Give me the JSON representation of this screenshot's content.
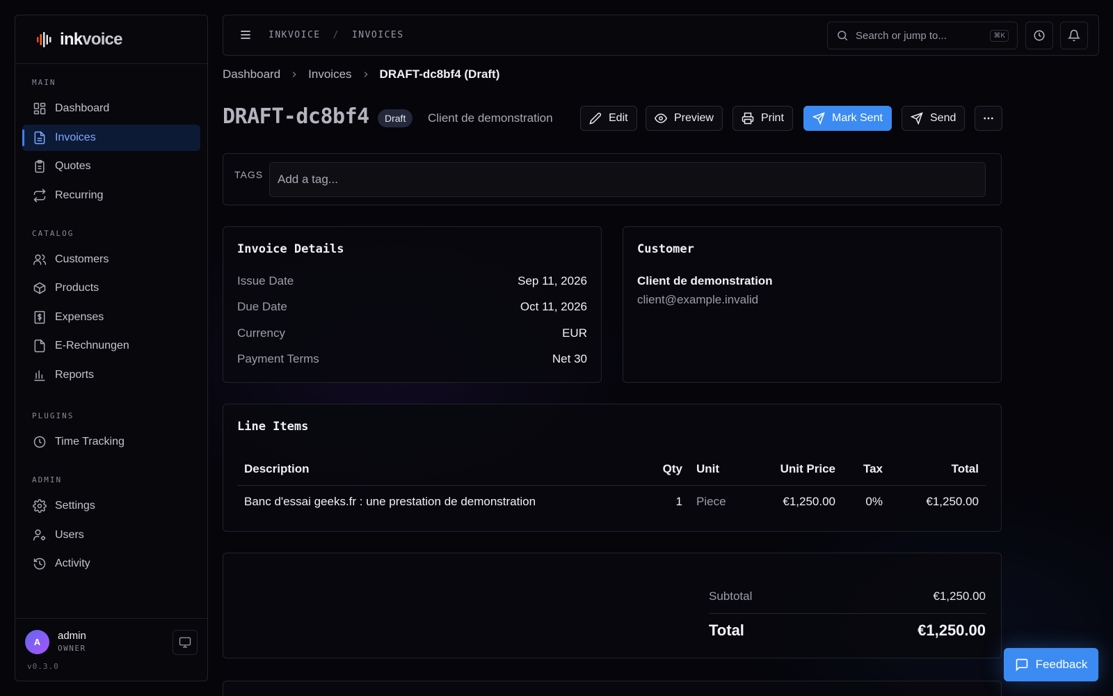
{
  "app": {
    "logo_text_bold": "ink",
    "logo_text_rest": "voice"
  },
  "sidebar": {
    "sections": [
      {
        "label": "MAIN"
      },
      {
        "label": "CATALOG"
      },
      {
        "label": "PLUGINS"
      },
      {
        "label": "ADMIN"
      }
    ],
    "items": [
      {
        "label": "Dashboard",
        "icon": "dashboard-icon"
      },
      {
        "label": "Invoices",
        "icon": "file-text-icon",
        "active": true
      },
      {
        "label": "Quotes",
        "icon": "clipboard-icon"
      },
      {
        "label": "Recurring",
        "icon": "repeat-icon"
      },
      {
        "label": "Customers",
        "icon": "users-icon"
      },
      {
        "label": "Products",
        "icon": "package-icon"
      },
      {
        "label": "Expenses",
        "icon": "receipt-icon"
      },
      {
        "label": "E-Rechnungen",
        "icon": "file-icon"
      },
      {
        "label": "Reports",
        "icon": "bar-chart-icon"
      },
      {
        "label": "Time Tracking",
        "icon": "clock-icon"
      },
      {
        "label": "Settings",
        "icon": "gear-icon"
      },
      {
        "label": "Users",
        "icon": "user-cog-icon"
      },
      {
        "label": "Activity",
        "icon": "history-icon"
      }
    ],
    "user": {
      "initial": "A",
      "name": "admin",
      "role": "OWNER"
    },
    "version": "v0.3.0"
  },
  "topbar": {
    "crumbs": [
      "INKVOICE",
      "/",
      "INVOICES"
    ],
    "search_placeholder": "Search or jump to...",
    "search_shortcut": "⌘K"
  },
  "breadcrumb": {
    "items": [
      "Dashboard",
      "Invoices"
    ],
    "current": "DRAFT-dc8bf4 (Draft)"
  },
  "header": {
    "title": "DRAFT-dc8bf4",
    "status": "Draft",
    "customer": "Client de demonstration",
    "actions": {
      "edit": "Edit",
      "preview": "Preview",
      "print": "Print",
      "mark_sent": "Mark Sent",
      "send": "Send"
    }
  },
  "tags": {
    "label": "TAGS",
    "placeholder": "Add a tag..."
  },
  "details": {
    "title": "Invoice Details",
    "rows": [
      {
        "key": "Issue Date",
        "value": "Sep 11, 2026"
      },
      {
        "key": "Due Date",
        "value": "Oct 11, 2026"
      },
      {
        "key": "Currency",
        "value": "EUR"
      },
      {
        "key": "Payment Terms",
        "value": "Net 30"
      }
    ]
  },
  "customer": {
    "title": "Customer",
    "name": "Client de demonstration",
    "email": "client@example.invalid"
  },
  "line_items": {
    "title": "Line Items",
    "headers": {
      "description": "Description",
      "qty": "Qty",
      "unit": "Unit",
      "unit_price": "Unit Price",
      "tax": "Tax",
      "total": "Total"
    },
    "rows": [
      {
        "description": "Banc d'essai geeks.fr : une prestation de demonstration",
        "qty": "1",
        "unit": "Piece",
        "unit_price": "€1,250.00",
        "tax": "0%",
        "total": "€1,250.00"
      }
    ]
  },
  "totals": {
    "subtotal_label": "Subtotal",
    "subtotal": "€1,250.00",
    "total_label": "Total",
    "total": "€1,250.00"
  },
  "feedback": {
    "label": "Feedback"
  },
  "colors": {
    "accent": "#3b8bf2",
    "active_nav_bg": "#0d1a36",
    "background": "#05050a"
  }
}
